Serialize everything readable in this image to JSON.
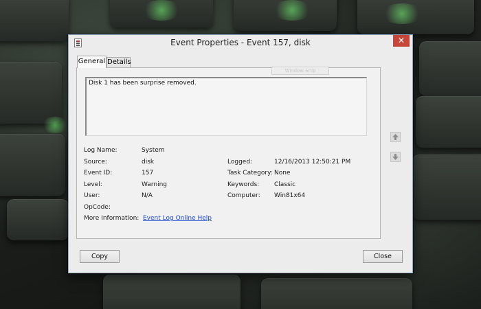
{
  "window": {
    "title": "Event Properties - Event 157, disk",
    "close_glyph": "✕"
  },
  "tabs": [
    {
      "label": "General",
      "selected": true
    },
    {
      "label": "Details",
      "selected": false
    }
  ],
  "ghost_overlay": "Window Snip",
  "message": "Disk 1 has been surprise removed.",
  "fields": {
    "log_name": {
      "label": "Log Name:",
      "value": "System"
    },
    "source": {
      "label": "Source:",
      "value": "disk"
    },
    "event_id": {
      "label": "Event ID:",
      "value": "157"
    },
    "level": {
      "label": "Level:",
      "value": "Warning"
    },
    "user": {
      "label": "User:",
      "value": "N/A"
    },
    "opcode": {
      "label": "OpCode:",
      "value": ""
    },
    "more_info": {
      "label": "More Information:",
      "value": "Event Log Online Help"
    },
    "logged": {
      "label": "Logged:",
      "value": "12/16/2013 12:50:21 PM"
    },
    "task_category": {
      "label": "Task Category:",
      "value": "None"
    },
    "keywords": {
      "label": "Keywords:",
      "value": "Classic"
    },
    "computer": {
      "label": "Computer:",
      "value": "Win81x64"
    }
  },
  "nav_icons": {
    "up": "arrow-up-icon",
    "down": "arrow-down-icon"
  },
  "buttons": {
    "copy": "Copy",
    "close": "Close"
  },
  "colors": {
    "close_button": "#c7463a",
    "link": "#1a47d6",
    "keyboard_glow": "#78ff78"
  }
}
